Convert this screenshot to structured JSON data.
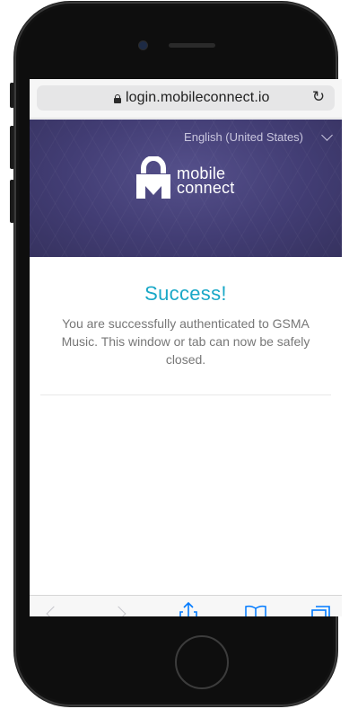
{
  "browser": {
    "url": "login.mobileconnect.io",
    "reload_glyph": "↻"
  },
  "header": {
    "language": "English (United States)",
    "brand_line1": "mobile",
    "brand_line2": "connect"
  },
  "main": {
    "title": "Success!",
    "message": "You are successfully authenticated to GSMA Music. This window or tab can now be safely closed."
  },
  "toolbar": {
    "icons": [
      "back-icon",
      "forward-icon",
      "share-icon",
      "bookmarks-icon",
      "tabs-icon"
    ]
  },
  "colors": {
    "accent": "#1aa8c7",
    "header_bg": "#423d74",
    "body_text": "#777777",
    "toolbar_icon": "#007aff"
  }
}
